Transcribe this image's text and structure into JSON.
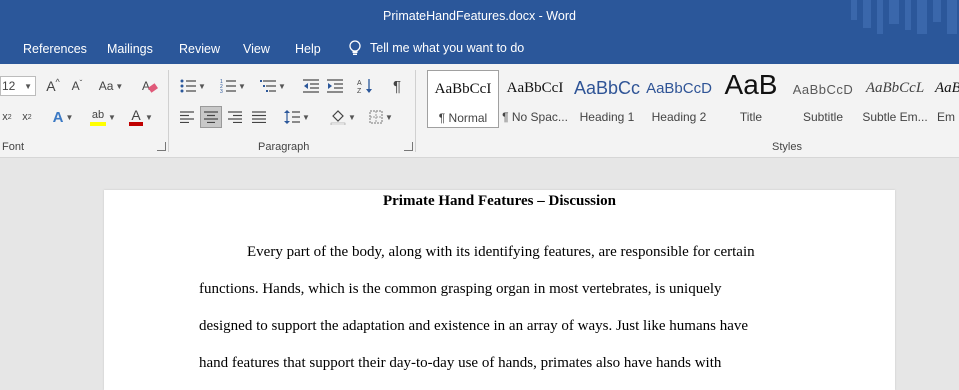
{
  "window": {
    "title": "PrimateHandFeatures.docx  -  Word"
  },
  "tabs": [
    "References",
    "Mailings",
    "Review",
    "View",
    "Help"
  ],
  "tell_me": {
    "placeholder": "Tell me what you want to do"
  },
  "font_group": {
    "size_value": "12",
    "label": "Font",
    "case_label": "Aa"
  },
  "paragraph_group": {
    "label": "Paragraph"
  },
  "styles_group": {
    "label": "Styles",
    "items": [
      {
        "preview": "AaBbCcI",
        "name": "¶ Normal",
        "selected": true
      },
      {
        "preview": "AaBbCcI",
        "name": "¶ No Spac..."
      },
      {
        "preview": "AaBbCc",
        "name": "Heading 1"
      },
      {
        "preview": "AaBbCcD",
        "name": "Heading 2"
      },
      {
        "preview": "AaB",
        "name": "Title"
      },
      {
        "preview": "AaBbCcD",
        "name": "Subtitle"
      },
      {
        "preview": "AaBbCcL",
        "name": "Subtle Em..."
      },
      {
        "preview": "AaB",
        "name": "Em"
      }
    ]
  },
  "document": {
    "title": "Primate Hand Features – Discussion",
    "lines": [
      "Every part of the body, along with its identifying features, are responsible for certain",
      "functions. Hands, which is the common grasping organ in most vertebrates, is uniquely",
      "designed to support the adaptation and existence in an array of ways. Just like humans have",
      "hand features that support their day-to-day use of hands, primates also have hands with"
    ]
  },
  "colors": {
    "accent": "#2b579a",
    "highlight": "#ffff00",
    "font_color": "#c00000"
  }
}
